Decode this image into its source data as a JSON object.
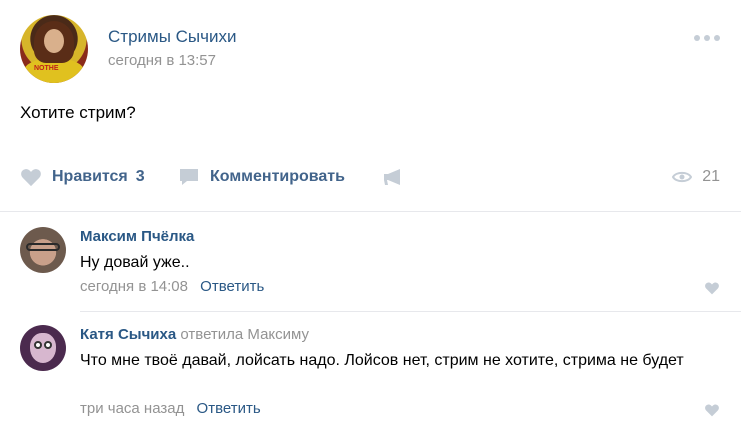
{
  "post": {
    "author": "Стримы Сычихи",
    "time": "сегодня в 13:57",
    "text": "Хотите стрим?"
  },
  "actions": {
    "like_label": "Нравится",
    "like_count": "3",
    "comment_label": "Комментировать",
    "views_count": "21"
  },
  "comments": [
    {
      "author": "Максим Пчёлка",
      "reply_to": "",
      "text": "Ну довай уже..",
      "time": "сегодня в 14:08",
      "reply_label": "Ответить"
    },
    {
      "author": "Катя Сычиха",
      "reply_to": "ответила Максиму",
      "text": "Что мне твоё давай, лойсать надо. Лойсов нет, стрим не хотите, стрима не будет",
      "time": "три часа назад",
      "reply_label": "Ответить"
    }
  ],
  "colors": {
    "link_blue": "#2a5885",
    "action_blue": "#42648b",
    "muted_gray": "#939393",
    "icon_gray": "#c5cdd6"
  }
}
